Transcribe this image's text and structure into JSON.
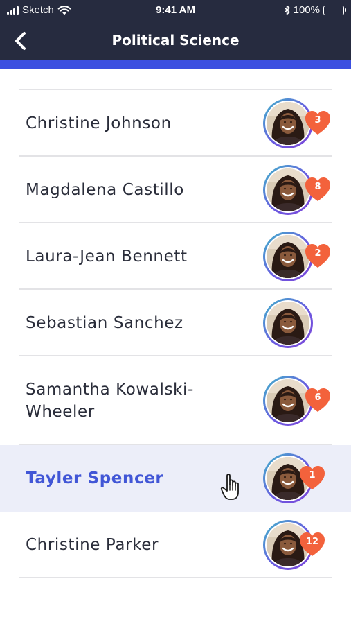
{
  "status_bar": {
    "carrier": "Sketch",
    "time": "9:41 AM",
    "battery": "100%"
  },
  "nav": {
    "title": "Political Science",
    "back_icon": "chevron-left-icon"
  },
  "colors": {
    "nav_background": "#262b3f",
    "accent": "#3b4fe0",
    "selected_row": "#eceef9",
    "selected_text": "#4156d6",
    "heart": "#f3623c"
  },
  "people": [
    {
      "name": "Christine Johnson",
      "likes": "3"
    },
    {
      "name": "Magdalena Castillo",
      "likes": "8"
    },
    {
      "name": "Laura-Jean Bennett",
      "likes": "2"
    },
    {
      "name": "Sebastian Sanchez",
      "likes": ""
    },
    {
      "name": "Samantha Kowalski-\nWheeler",
      "likes": "6"
    },
    {
      "name": "Tayler Spencer",
      "likes": "1",
      "selected": true
    },
    {
      "name": "Christine Parker",
      "likes": "12"
    }
  ]
}
